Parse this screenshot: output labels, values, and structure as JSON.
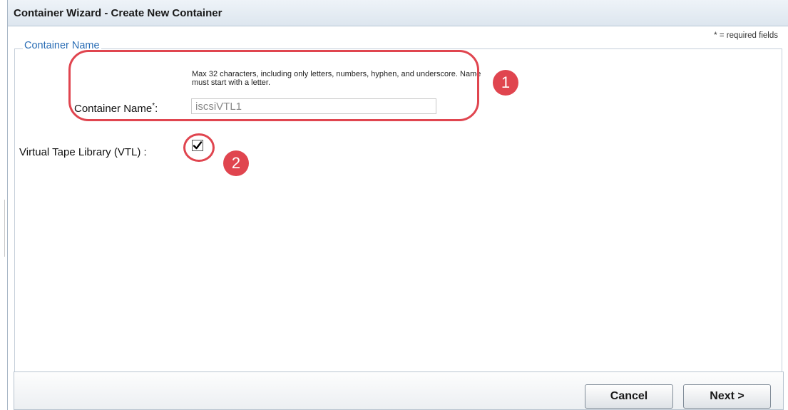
{
  "window": {
    "title": "Container Wizard - Create New Container"
  },
  "required_note": "* = required fields",
  "section": {
    "legend": "Container Name"
  },
  "container_name": {
    "hint": "Max 32 characters, including only letters, numbers, hyphen, and underscore. Name must start with a letter.",
    "label": "Container Name",
    "required_mark": "*",
    "label_suffix": ":",
    "value": "iscsiVTL1"
  },
  "vtl": {
    "label": "Virtual Tape Library (VTL) :",
    "checked": true,
    "check_glyph": "✔"
  },
  "callouts": {
    "one": "1",
    "two": "2",
    "color": "#e0454f"
  },
  "footer": {
    "cancel_label": "Cancel",
    "next_label": "Next >"
  }
}
